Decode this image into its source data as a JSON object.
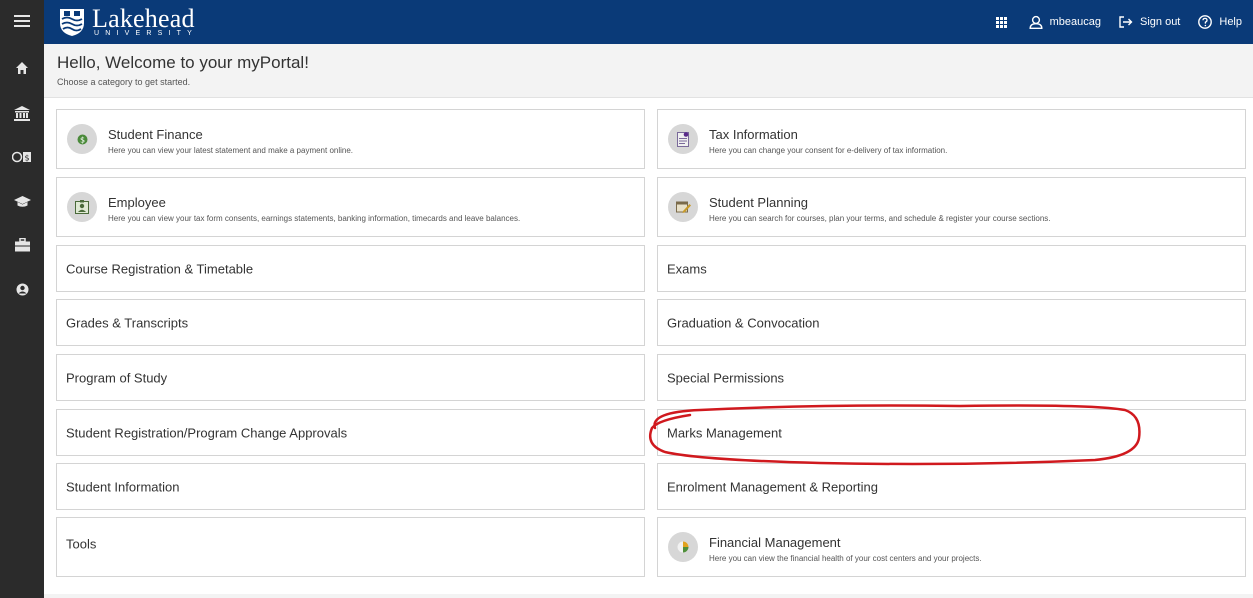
{
  "brand": {
    "name": "Lakehead",
    "sub": "UNIVERSITY"
  },
  "header": {
    "user": "mbeaucag",
    "signout": "Sign out",
    "help": "Help"
  },
  "welcome": {
    "title": "Hello, Welcome to your myPortal!",
    "subtitle": "Choose a category to get started."
  },
  "nav_icons": [
    "menu-icon",
    "home-icon",
    "bank-icon",
    "finance-icon",
    "graduation-cap-icon",
    "briefcase-icon",
    "user-circle-icon"
  ],
  "cards": {
    "student_finance": {
      "title": "Student Finance",
      "desc": "Here you can view your latest statement and make a payment online."
    },
    "tax_information": {
      "title": "Tax Information",
      "desc": "Here you can change your consent for e-delivery of tax information."
    },
    "employee": {
      "title": "Employee",
      "desc": "Here you can view your tax form consents, earnings statements, banking information, timecards and leave balances."
    },
    "student_planning": {
      "title": "Student Planning",
      "desc": "Here you can search for courses, plan your terms, and schedule & register your course sections."
    },
    "course_registration": {
      "title": "Course Registration & Timetable"
    },
    "exams": {
      "title": "Exams"
    },
    "grades": {
      "title": "Grades & Transcripts"
    },
    "graduation": {
      "title": "Graduation & Convocation"
    },
    "program_of_study": {
      "title": "Program of Study"
    },
    "special_permissions": {
      "title": "Special Permissions"
    },
    "registration_approvals": {
      "title": "Student Registration/Program Change Approvals"
    },
    "marks_management": {
      "title": "Marks Management"
    },
    "student_information": {
      "title": "Student Information"
    },
    "enrolment_management": {
      "title": "Enrolment Management & Reporting"
    },
    "tools": {
      "title": "Tools"
    },
    "financial_management": {
      "title": "Financial Management",
      "desc": "Here you can view the financial health of your cost centers and your projects."
    }
  },
  "colors": {
    "header": "#0a3a78",
    "sidebar": "#2b2b2b",
    "annotation": "#d0191e"
  }
}
